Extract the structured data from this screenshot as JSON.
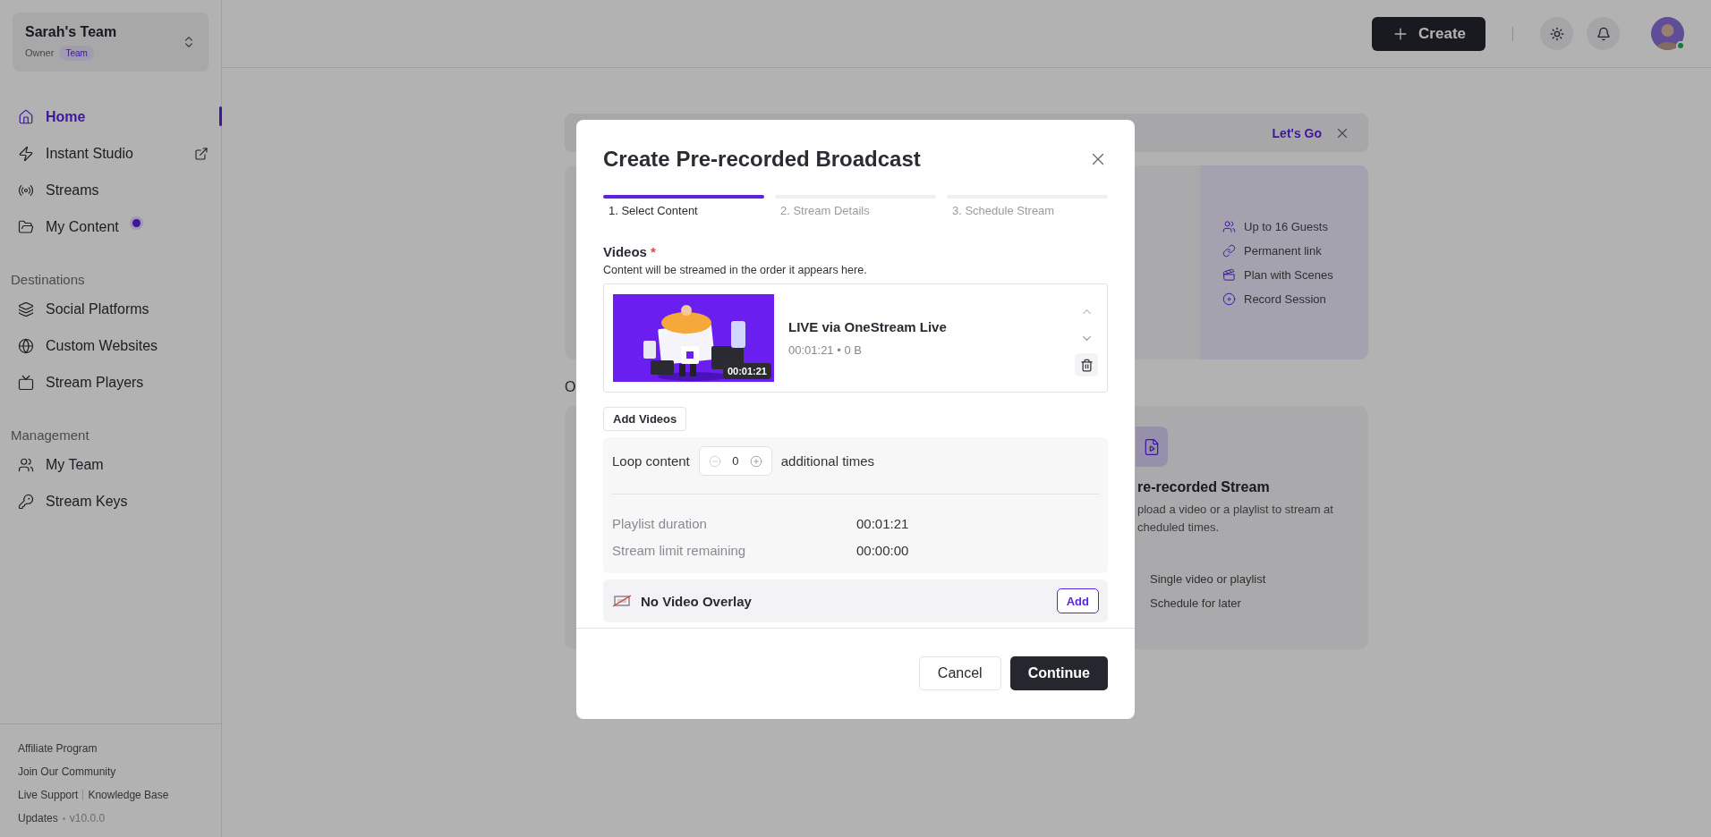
{
  "team": {
    "name": "Sarah's Team",
    "role": "Owner",
    "badge": "Team"
  },
  "nav": [
    {
      "label": "Home",
      "selected": true,
      "external": false,
      "dot": false
    },
    {
      "label": "Instant Studio",
      "selected": false,
      "external": true,
      "dot": false
    },
    {
      "label": "Streams",
      "selected": false,
      "external": false,
      "dot": false
    },
    {
      "label": "My Content",
      "selected": false,
      "external": false,
      "dot": true
    }
  ],
  "sections": [
    {
      "title": "Destinations",
      "items": [
        {
          "label": "Social Platforms",
          "selected": false
        },
        {
          "label": "Custom Websites",
          "selected": false
        },
        {
          "label": "Stream Players",
          "selected": false
        }
      ]
    },
    {
      "title": "Management",
      "items": [
        {
          "label": "My Team",
          "selected": false
        },
        {
          "label": "Stream Keys",
          "selected": false
        }
      ]
    }
  ],
  "footer": [
    {
      "links": [
        "Affiliate Program"
      ]
    },
    {
      "links": [
        "Join Our Community"
      ]
    },
    {
      "links": [
        "Live Support",
        "Knowledge Base"
      ]
    },
    {
      "links": [
        "Updates"
      ],
      "version": "v10.0.0"
    }
  ],
  "topbar": {
    "create": "Create",
    "online": true
  },
  "banner": {
    "link": "Let's Go"
  },
  "features": [
    "Up to 16 Guests",
    "Permanent link",
    "Plan with Scenes",
    "Record Session"
  ],
  "section_heading": "O",
  "prerecorded": {
    "title": "re-recorded Stream",
    "description": [
      "pload a video or a playlist to stream at",
      "cheduled times."
    ],
    "features": [
      "Single video or playlist",
      "Schedule for later"
    ]
  },
  "modal": {
    "title": "Create Pre-recorded Broadcast",
    "steps": [
      {
        "label": "1. Select Content",
        "selected": true
      },
      {
        "label": "2. Stream Details",
        "selected": false
      },
      {
        "label": "3. Schedule Stream",
        "selected": false
      }
    ],
    "videos_label": "Videos",
    "required_mark": "*",
    "hint": "Content will be streamed in the order it appears here.",
    "videos": [
      {
        "kind": "picture",
        "title": "LIVE via OneStream Live",
        "meta": "00:01:21 • 0 B",
        "duration": "00:01:21"
      }
    ],
    "add_videos": "Add Videos",
    "loop": {
      "label": "Loop content",
      "value": "0",
      "suffix": "additional times"
    },
    "stats": [
      {
        "label": "Playlist duration",
        "value": "00:01:21"
      },
      {
        "label": "Stream limit remaining",
        "value": "00:00:00"
      }
    ],
    "overlay": {
      "label": "No Video Overlay",
      "action": "Add"
    },
    "buttons": {
      "cancel": "Cancel",
      "continue": "Continue"
    }
  }
}
